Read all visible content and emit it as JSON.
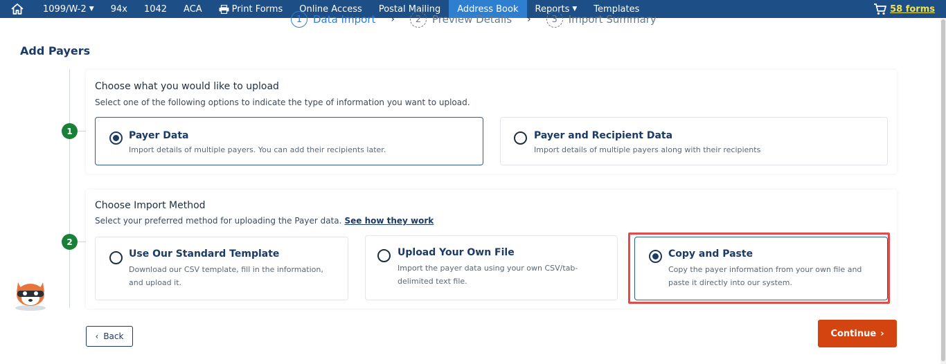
{
  "nav": {
    "items": [
      {
        "label": "1099/W-2",
        "has_caret": true
      },
      {
        "label": "94x"
      },
      {
        "label": "1042"
      },
      {
        "label": "ACA"
      },
      {
        "label": "Print Forms",
        "icon": "printer-icon"
      },
      {
        "label": "Online Access"
      },
      {
        "label": "Postal Mailing"
      },
      {
        "label": "Address Book",
        "active": true
      },
      {
        "label": "Reports",
        "has_caret": true
      },
      {
        "label": "Templates"
      }
    ],
    "cart_label": "58 forms",
    "accent": "#1e4e86",
    "active_color": "#2f7fd1"
  },
  "stepper": {
    "steps": [
      {
        "num": "1",
        "label": "Data Import"
      },
      {
        "num": "2",
        "label": "Preview Details"
      },
      {
        "num": "3",
        "label": "Import Summary"
      }
    ]
  },
  "page": {
    "title": "Add Payers"
  },
  "section1": {
    "step": "1",
    "title": "Choose what you would like to upload",
    "subtitle": "Select one of the following options to indicate the type of information you want to upload.",
    "options": [
      {
        "title": "Payer Data",
        "desc": "Import details of multiple payers. You can add their recipients later.",
        "selected": true
      },
      {
        "title": "Payer and Recipient Data",
        "desc": "Import details of multiple payers along with their recipients",
        "selected": false
      }
    ]
  },
  "section2": {
    "step": "2",
    "title": "Choose Import Method",
    "subtitle": "Select your preferred method for uploading the Payer data.",
    "link": "See how they work",
    "options": [
      {
        "title": "Use Our Standard Template",
        "desc1": "Download our CSV template, fill in the information,",
        "desc2": "and upload it.",
        "selected": false
      },
      {
        "title": "Upload Your Own File",
        "desc1": "Import the payer data using your own CSV/tab-",
        "desc2": "delimited text file.",
        "selected": false
      },
      {
        "title": "Copy and Paste",
        "desc1": "Copy the payer information from your own file and",
        "desc2": "paste it directly into our system.",
        "selected": true
      }
    ]
  },
  "buttons": {
    "back": "Back",
    "continue": "Continue"
  },
  "colors": {
    "primary_text": "#1b3a66",
    "step_green": "#1a7f37",
    "continue_bg": "#d44410",
    "highlight": "#e14b4b"
  }
}
